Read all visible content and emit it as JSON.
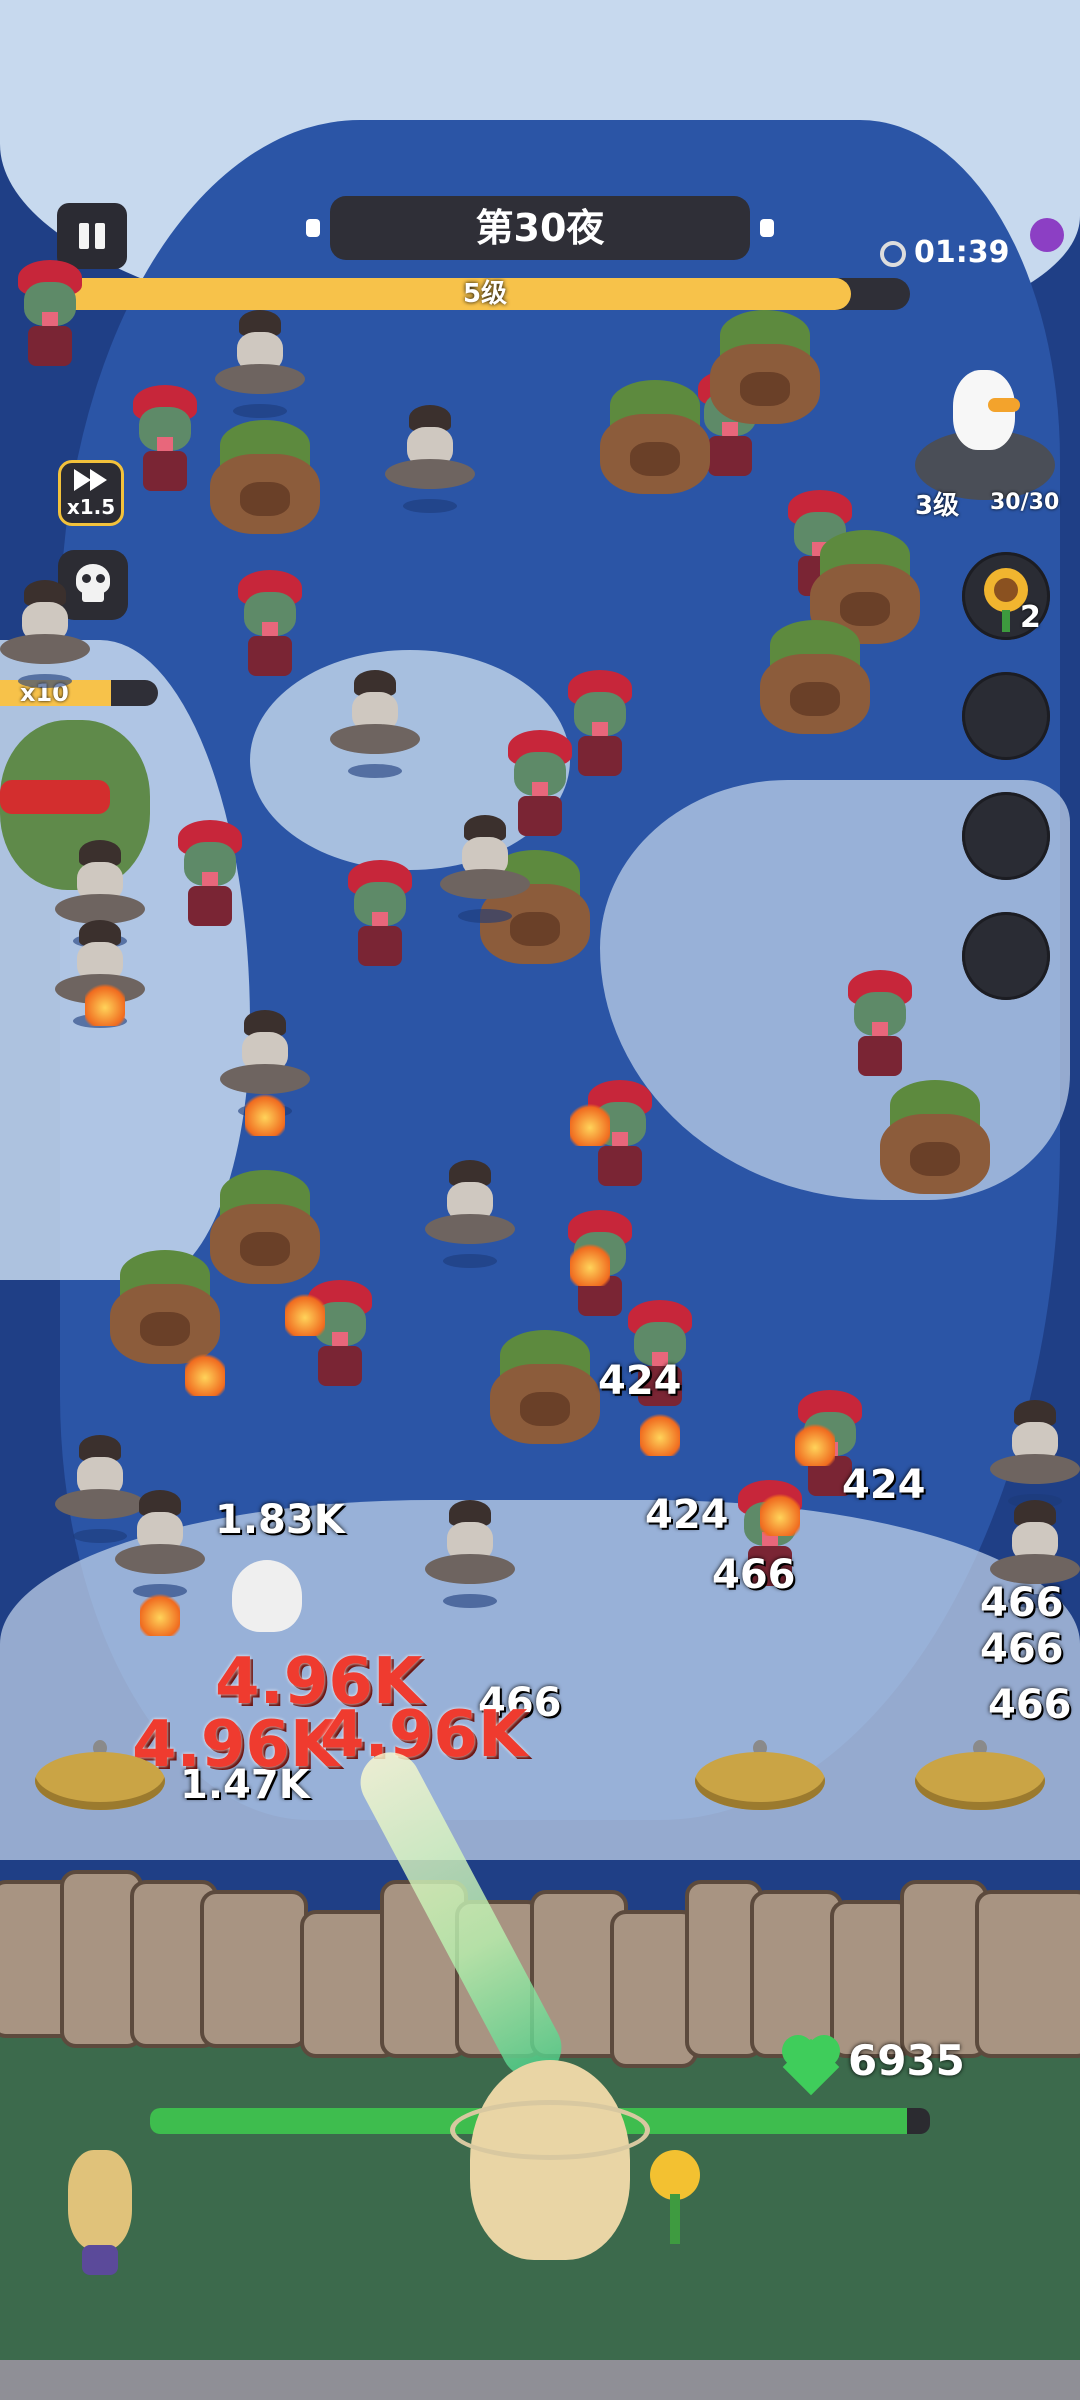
{
  "hud": {
    "title": "第30夜",
    "timer": "01:39",
    "level_label": "5级",
    "level_progress": 0.93,
    "speed_label": "x1.5",
    "kill_multiplier": "x10",
    "kill_progress": 0.7
  },
  "pet": {
    "level": "3级",
    "count": "30/30"
  },
  "skills": {
    "sunflower_count": "2",
    "empty_slots": 3
  },
  "damage_numbers": {
    "d1": "424",
    "d2": "424",
    "d3": "424",
    "d4": "466",
    "d5": "466",
    "d6": "466",
    "d7": "466",
    "d8": "1.83K",
    "d9": "1.47K",
    "d10": "4.96K",
    "d11": "4.96K",
    "d12": "4.96K",
    "d13": "466"
  },
  "base": {
    "hp": "6935",
    "hp_progress": 0.97
  },
  "colors": {
    "water": "#2b55a6",
    "snow": "#c7d9ee",
    "accent_bar": "#f7c24a",
    "hp_green": "#3ebd4e",
    "crit_red": "#ef3b2f"
  }
}
